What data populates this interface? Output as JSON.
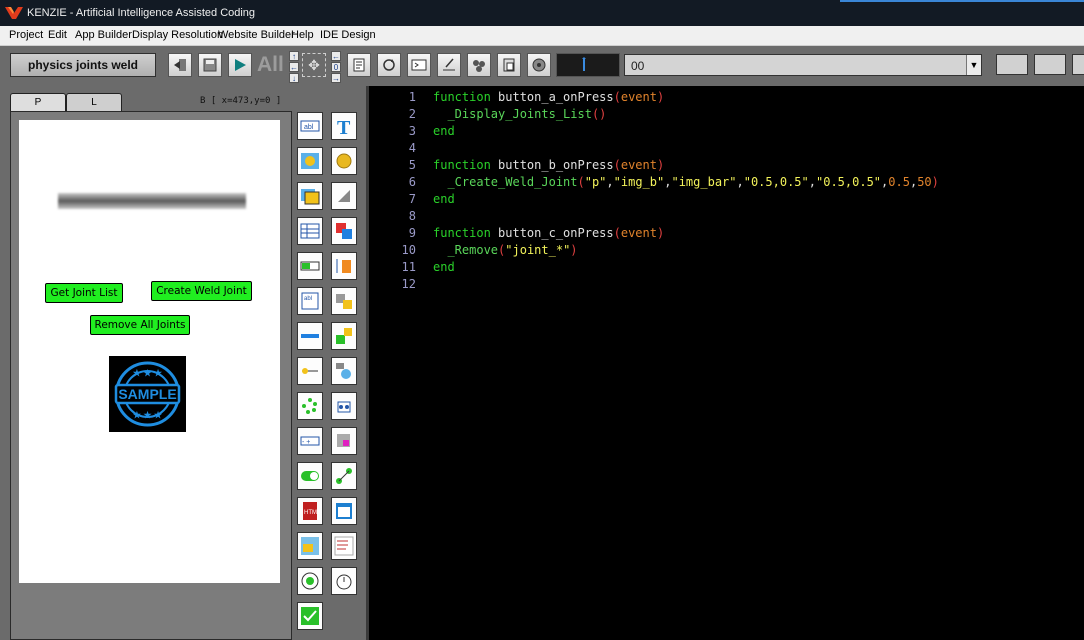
{
  "app": {
    "title": "KENZIE - Artificial Intelligence Assisted Coding"
  },
  "menu": {
    "items": [
      "Project",
      "Edit",
      "App Builder",
      "Display Resolution",
      "Website Builder",
      "Help",
      "IDE Design"
    ]
  },
  "toolbar": {
    "project_name": "physics joints weld",
    "all_label": "All",
    "dropdown_value": "00",
    "buttons": [
      "export-icon",
      "save-icon",
      "run-icon",
      "page-icon",
      "refresh-icon",
      "terminal-icon",
      "sign-icon",
      "settings-icon",
      "paste-icon",
      "sound-icon",
      "transfer-icon"
    ]
  },
  "left_panel": {
    "tabs": [
      "P",
      "L"
    ],
    "coords": "B [ x=473,y=0 ]",
    "buttons": {
      "get_joint_list": "Get Joint List",
      "create_weld_joint": "Create Weld Joint",
      "remove_all_joints": "Remove All Joints"
    },
    "sample_text": "SAMPLE"
  },
  "toolbox": {
    "tools": [
      "textbox-icon",
      "text-icon",
      "image-icon",
      "button-icon",
      "image-gallery-icon",
      "rotate-icon",
      "table-icon",
      "collision-icon",
      "progress-icon",
      "scale-icon",
      "textarea-icon",
      "group-icon",
      "slider-icon",
      "joint-icon",
      "toggle-switch-icon",
      "link-icon",
      "spinner-icon",
      "align-icon",
      "stepper-icon",
      "anchor-icon",
      "switch-icon",
      "connect-icon",
      "html-icon",
      "web-icon",
      "map-icon",
      "list-icon",
      "radio-icon",
      "timer-icon",
      "checkbox-icon"
    ]
  },
  "editor": {
    "lines": [
      {
        "n": "1",
        "tokens": [
          [
            "kw",
            "function "
          ],
          [
            "fn",
            "button_a_onPress"
          ],
          [
            "paren",
            "("
          ],
          [
            "param",
            "event"
          ],
          [
            "paren",
            ")"
          ]
        ]
      },
      {
        "n": "2",
        "tokens": [
          [
            "fn",
            "  "
          ],
          [
            "call",
            "_Display_Joints_List"
          ],
          [
            "paren",
            "()"
          ]
        ]
      },
      {
        "n": "3",
        "tokens": [
          [
            "kw",
            "end"
          ]
        ]
      },
      {
        "n": "4",
        "tokens": []
      },
      {
        "n": "5",
        "tokens": [
          [
            "kw",
            "function "
          ],
          [
            "fn",
            "button_b_onPress"
          ],
          [
            "paren",
            "("
          ],
          [
            "param",
            "event"
          ],
          [
            "paren",
            ")"
          ]
        ]
      },
      {
        "n": "6",
        "tokens": [
          [
            "fn",
            "  "
          ],
          [
            "call",
            "_Create_Weld_Joint"
          ],
          [
            "paren",
            "("
          ],
          [
            "str",
            "\"p\""
          ],
          [
            "fn",
            ","
          ],
          [
            "str",
            "\"img_b\""
          ],
          [
            "fn",
            ","
          ],
          [
            "str",
            "\"img_bar\""
          ],
          [
            "fn",
            ","
          ],
          [
            "str",
            "\"0.5,0.5\""
          ],
          [
            "fn",
            ","
          ],
          [
            "str",
            "\"0.5,0.5\""
          ],
          [
            "fn",
            ","
          ],
          [
            "num",
            "0.5"
          ],
          [
            "fn",
            ","
          ],
          [
            "num",
            "50"
          ],
          [
            "paren",
            ")"
          ]
        ]
      },
      {
        "n": "7",
        "tokens": [
          [
            "kw",
            "end"
          ]
        ]
      },
      {
        "n": "8",
        "tokens": []
      },
      {
        "n": "9",
        "tokens": [
          [
            "kw",
            "function "
          ],
          [
            "fn",
            "button_c_onPress"
          ],
          [
            "paren",
            "("
          ],
          [
            "param",
            "event"
          ],
          [
            "paren",
            ")"
          ]
        ]
      },
      {
        "n": "10",
        "tokens": [
          [
            "fn",
            "  "
          ],
          [
            "call",
            "_Remove"
          ],
          [
            "paren",
            "("
          ],
          [
            "str",
            "\"joint_*\""
          ],
          [
            "paren",
            ")"
          ]
        ]
      },
      {
        "n": "11",
        "tokens": [
          [
            "kw",
            "end"
          ]
        ]
      },
      {
        "n": "12",
        "tokens": []
      }
    ]
  },
  "colors": {
    "keyword": "#2ad12a",
    "string": "#f2f25a",
    "param": "#e0832c",
    "paren": "#e04040",
    "line_number": "#9a9ac8",
    "button_green": "#20ee20"
  }
}
